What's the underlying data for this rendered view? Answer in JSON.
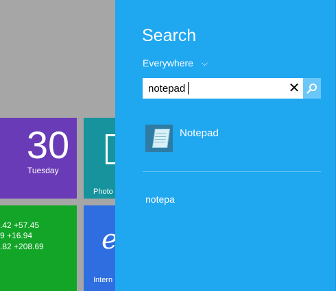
{
  "start_screen": {
    "calendar": {
      "day": "30",
      "weekday": "Tuesday"
    },
    "photos": {
      "label": "Photo"
    },
    "finance": {
      "lines": [
        ".42 +57.45",
        "9 +16.94",
        ".82 +208.69"
      ]
    },
    "ie": {
      "label": "Intern"
    }
  },
  "search_pane": {
    "title": "Search",
    "scope_label": "Everywhere",
    "query": "notepad",
    "clear_icon": "✕",
    "results": [
      {
        "label": "Notepad",
        "icon": "notepad-icon"
      }
    ],
    "suggestions": [
      "notepa"
    ]
  },
  "colors": {
    "charm_bg": "#1fa7f0",
    "calendar_tile": "#6a3bb6",
    "photos_tile": "#16939c",
    "finance_tile": "#12a527",
    "ie_tile": "#2f6ee0"
  }
}
